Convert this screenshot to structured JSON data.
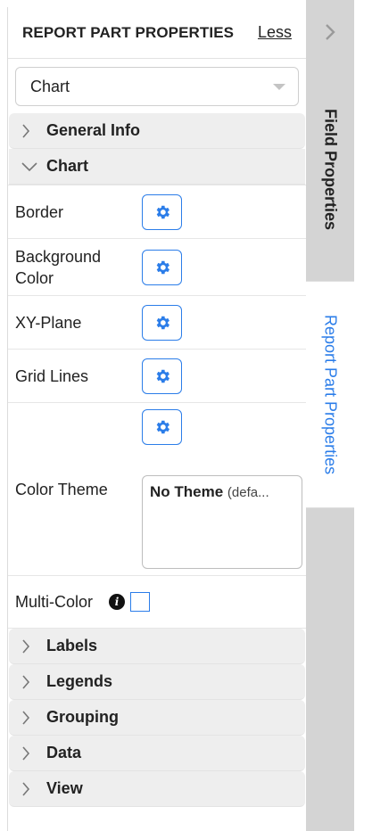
{
  "header": {
    "title": "REPORT PART PROPERTIES",
    "less_link": "Less"
  },
  "part_selector": {
    "value": "Chart"
  },
  "sections": {
    "general_info": "General Info",
    "chart": "Chart",
    "labels": "Labels",
    "legends": "Legends",
    "grouping": "Grouping",
    "data": "Data",
    "view": "View"
  },
  "chart_props": {
    "border": "Border",
    "background_color": "Background Color",
    "xy_plane": "XY-Plane",
    "grid_lines": "Grid Lines",
    "color_theme": "Color Theme",
    "color_theme_value": "No Theme",
    "color_theme_suffix": "(defa...",
    "multi_color": "Multi-Color"
  },
  "side_tabs": {
    "field_properties": "Field Properties",
    "report_part_properties": "Report Part Properties"
  },
  "icons": {
    "gear": "gear-icon",
    "chevron_right": "chevron-right-icon",
    "chevron_down": "chevron-down-icon",
    "info": "info-icon",
    "dropdown_caret": "caret-down-icon"
  },
  "colors": {
    "accent": "#2b7de9",
    "section_bg": "#eeeeee",
    "rail_bg": "#d4d4d4"
  }
}
